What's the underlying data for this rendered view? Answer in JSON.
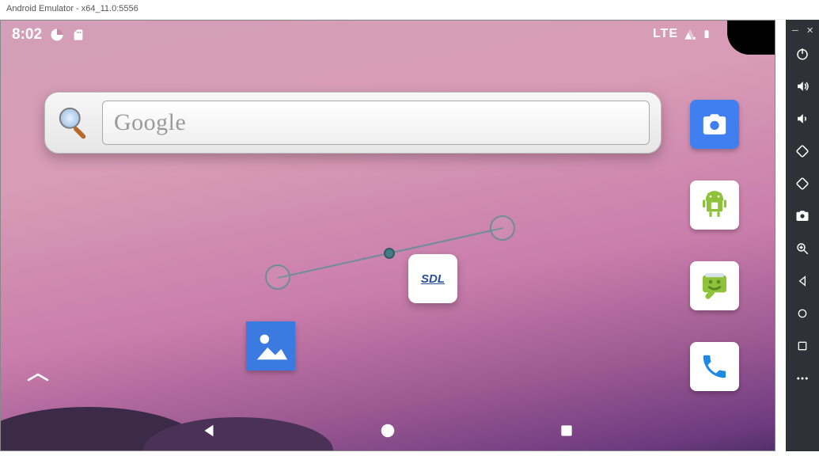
{
  "window": {
    "title": "Android Emulator - x64_11.0:5556"
  },
  "statusbar": {
    "clock": "8:02",
    "network": "LTE"
  },
  "search": {
    "placeholder": "Google"
  },
  "home_icons": {
    "sdl_label": "SDL"
  },
  "dock": {
    "camera": "camera",
    "robot": "android-robot",
    "messages": "messages",
    "phone": "phone"
  },
  "toolbar": {
    "items": [
      "power",
      "volume-up",
      "volume-down",
      "rotate-left",
      "rotate-right",
      "screenshot",
      "zoom",
      "back",
      "overview",
      "home",
      "more"
    ]
  }
}
